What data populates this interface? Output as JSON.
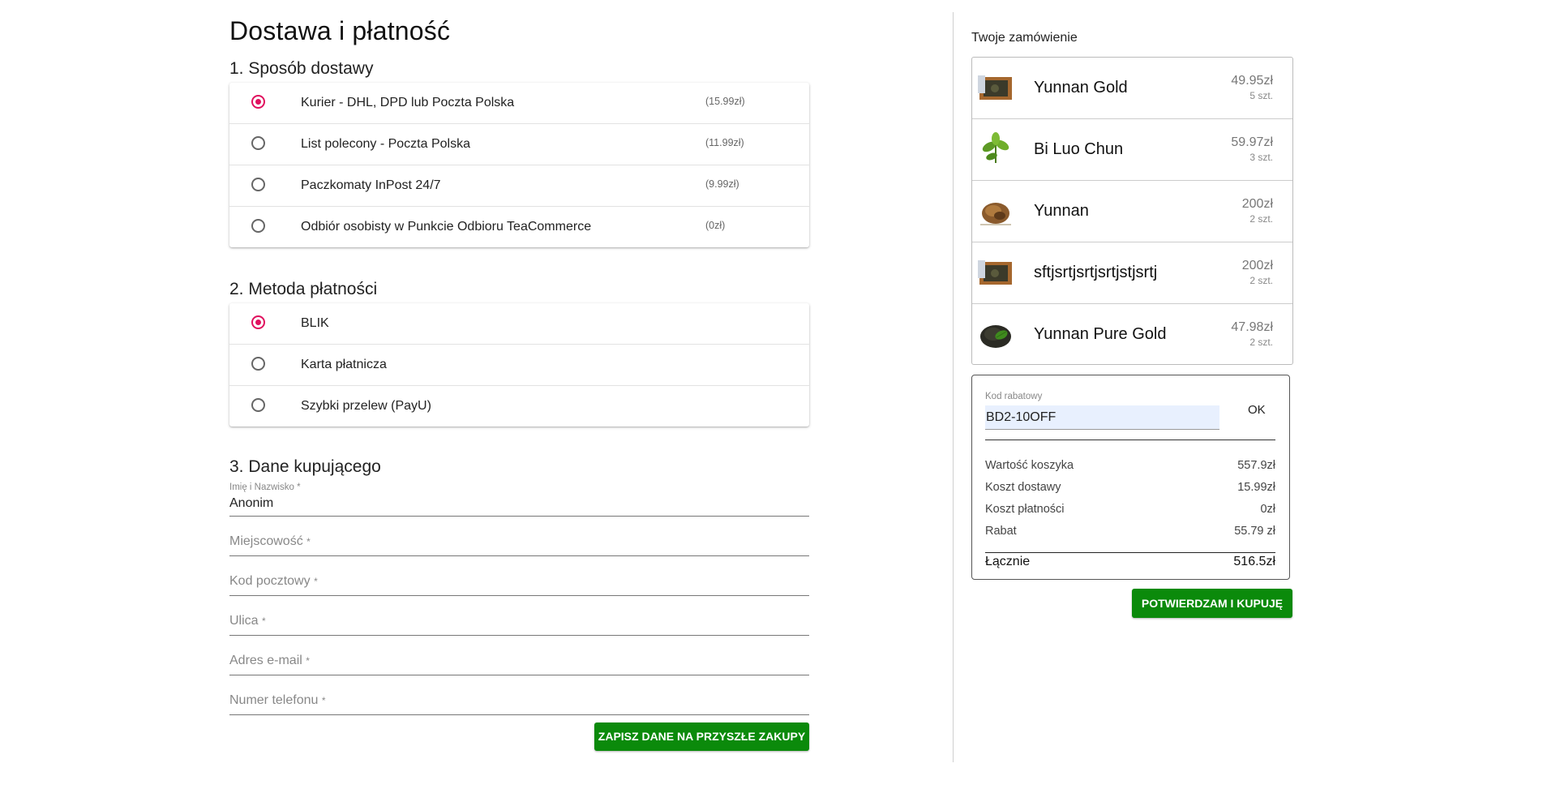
{
  "page_title": "Dostawa i płatność",
  "delivery": {
    "title": "1. Sposób dostawy",
    "options": [
      {
        "label": "Kurier - DHL, DPD lub Poczta Polska",
        "price": "(15.99zł)",
        "selected": true
      },
      {
        "label": "List polecony - Poczta Polska",
        "price": "(11.99zł)",
        "selected": false
      },
      {
        "label": "Paczkomaty InPost 24/7",
        "price": "(9.99zł)",
        "selected": false
      },
      {
        "label": "Odbiór osobisty w Punkcie Odbioru TeaCommerce",
        "price": "(0zł)",
        "selected": false
      }
    ]
  },
  "payment": {
    "title": "2. Metoda płatności",
    "options": [
      {
        "label": "BLIK",
        "selected": true
      },
      {
        "label": "Karta płatnicza",
        "selected": false
      },
      {
        "label": "Szybki przelew (PayU)",
        "selected": false
      }
    ]
  },
  "buyer": {
    "title": "3. Dane kupującego",
    "name_label": "Imię i Nazwisko *",
    "name_value": "Anonim",
    "city_label": "Miejscowość",
    "postcode_label": "Kod pocztowy",
    "street_label": "Ulica",
    "email_label": "Adres e-mail",
    "phone_label": "Numer telefonu",
    "required_mark": "*",
    "save_button": "ZAPISZ DANE NA PRZYSZŁE ZAKUPY"
  },
  "order": {
    "title": "Twoje zamówienie",
    "items": [
      {
        "name": "Yunnan Gold",
        "price": "49.95zł",
        "qty": "5 szt.",
        "icon": "tea-box-icon"
      },
      {
        "name": "Bi Luo Chun",
        "price": "59.97zł",
        "qty": "3 szt.",
        "icon": "tea-leaf-icon"
      },
      {
        "name": "Yunnan",
        "price": "200zł",
        "qty": "2 szt.",
        "icon": "loose-tea-icon"
      },
      {
        "name": "sftjsrtjsrtjsrtjstjsrtj",
        "price": "200zł",
        "qty": "2 szt.",
        "icon": "tea-box-icon"
      },
      {
        "name": "Yunnan Pure Gold",
        "price": "47.98zł",
        "qty": "2 szt.",
        "icon": "tea-pile-icon"
      }
    ]
  },
  "summary": {
    "coupon_label": "Kod rabatowy",
    "coupon_value": "BD2-10OFF",
    "ok_label": "OK",
    "cart_value_label": "Wartość koszyka",
    "cart_value": "557.9zł",
    "delivery_cost_label": "Koszt dostawy",
    "delivery_cost": "15.99zł",
    "payment_cost_label": "Koszt płatności",
    "payment_cost": "0zł",
    "discount_label": "Rabat",
    "discount": "55.79 zł",
    "total_label": "Łącznie",
    "total": "516.5zł",
    "buy_button": "POTWIERDZAM I KUPUJĘ"
  },
  "colors": {
    "accent_radio": "#e0105e",
    "button_green": "#0b8a0b"
  }
}
